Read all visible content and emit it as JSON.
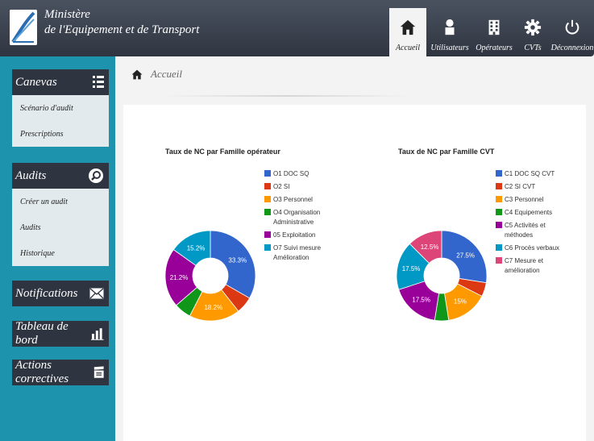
{
  "app": {
    "title_line1": "Ministère",
    "title_line2": "de l'Equipement et de Transport"
  },
  "nav": [
    {
      "label": "Accueil",
      "icon": "home-icon"
    },
    {
      "label": "Utilisateurs",
      "icon": "user-icon"
    },
    {
      "label": "Opérateurs",
      "icon": "building-icon"
    },
    {
      "label": "CVTs",
      "icon": "gear-icon"
    },
    {
      "label": "Déconnexion",
      "icon": "power-icon"
    }
  ],
  "sidebar": {
    "canevas": {
      "title": "Canevas",
      "items": [
        "Scénario d'audit",
        "Prescriptions"
      ]
    },
    "audits": {
      "title": "Audits",
      "items": [
        "Créer un audit",
        "Audits",
        "Historique"
      ]
    },
    "notifications": {
      "title": "Notifications"
    },
    "tableau": {
      "title": "Tableau de bord"
    },
    "actions": {
      "title": "Actions correctives"
    }
  },
  "breadcrumb": {
    "label": "Accueil"
  },
  "colors": {
    "header": "#2f3540",
    "sidebar": "#1d93ad",
    "blue": "#3366cc",
    "red": "#dc3912",
    "orange": "#ff9900",
    "green": "#109618",
    "purple": "#990099",
    "teal": "#0099c6",
    "pink": "#dd4477"
  },
  "chart_data": [
    {
      "type": "pie",
      "title": "Taux de NC par Famille opérateur",
      "categories": [
        "O1 DOC SQ",
        "O2 SI",
        "O3 Personnel",
        "O4 Organisation Administrative",
        "05 Exploitation",
        "O7 Suivi mesure Amélioration"
      ],
      "values": [
        33.3,
        6.1,
        18.2,
        6.1,
        21.2,
        15.2
      ],
      "labels": [
        "33.3%",
        "",
        "18.2%",
        "",
        "21.2%",
        "15.2%"
      ],
      "colors": [
        "#3366cc",
        "#dc3912",
        "#ff9900",
        "#109618",
        "#990099",
        "#0099c6"
      ],
      "legend": "right"
    },
    {
      "type": "pie",
      "title": "Taux de NC par Famille CVT",
      "categories": [
        "C1 DOC SQ CVT",
        "C2 SI CVT",
        "C3 Personnel",
        "C4 Equipements",
        "C5 Activités et méthodes",
        "C6 Procès verbaux",
        "C7 Mesure et amélioration"
      ],
      "values": [
        27.5,
        5,
        15,
        5,
        17.5,
        17.5,
        12.5
      ],
      "labels": [
        "27.5%",
        "",
        "15%",
        "",
        "17.5%",
        "17.5%",
        "12.5%"
      ],
      "colors": [
        "#3366cc",
        "#dc3912",
        "#ff9900",
        "#109618",
        "#990099",
        "#0099c6",
        "#dd4477"
      ],
      "legend": "right"
    }
  ]
}
